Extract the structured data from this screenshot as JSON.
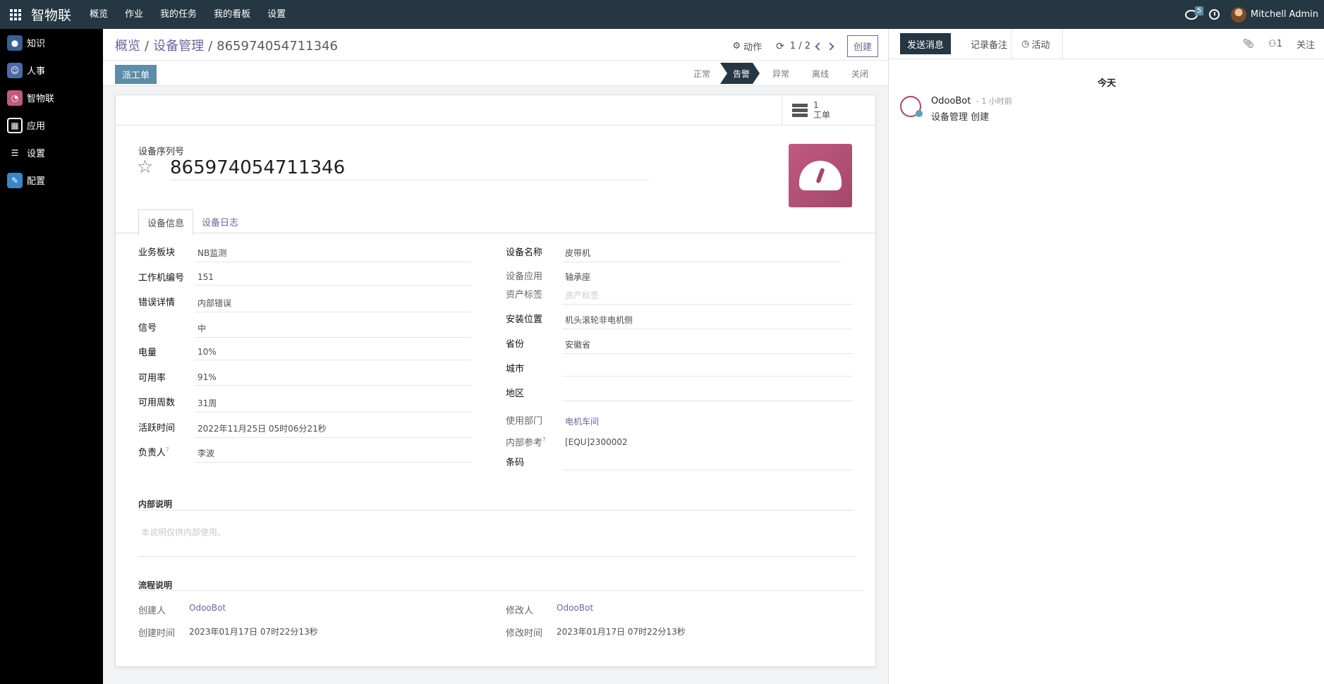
{
  "topbar": {
    "brand": "智物联",
    "menu": [
      "概览",
      "作业",
      "我的任务",
      "我的看板",
      "设置"
    ],
    "chat_count": "5",
    "user_name": "Mitchell Admin"
  },
  "sidebar": {
    "items": [
      {
        "label": "知识",
        "color": "#3a5f95"
      },
      {
        "label": "人事",
        "color": "#4c6aa6"
      },
      {
        "label": "智物联",
        "color": "#c05a80"
      },
      {
        "label": "应用",
        "color": "#000000"
      },
      {
        "label": "设置",
        "color": "#000000"
      },
      {
        "label": "配置",
        "color": "#3a86c8"
      }
    ]
  },
  "control_panel": {
    "breadcrumb": [
      "概览",
      "设备管理",
      "865974054711346"
    ],
    "action_label": "动作",
    "pager": "1 / 2",
    "create_label": "创建",
    "dispatch_label": "派工单",
    "statuses": [
      "正常",
      "告警",
      "异常",
      "离线",
      "关闭"
    ],
    "active_status": "告警"
  },
  "form": {
    "smart_button": {
      "count": "1",
      "label": "工单"
    },
    "serial_label": "设备序列号",
    "serial_value": "865974054711346",
    "tabs": [
      "设备信息",
      "设备日志"
    ],
    "left_fields": [
      {
        "label": "业务板块",
        "value": "NB监测"
      },
      {
        "label": "工作机编号",
        "value": "151"
      },
      {
        "label": "错误详情",
        "value": "内部错误"
      },
      {
        "label": "信号",
        "value": "中"
      },
      {
        "label": "电量",
        "value": "10%"
      },
      {
        "label": "可用率",
        "value": "91%"
      },
      {
        "label": "可用周数",
        "value": "31周"
      },
      {
        "label": "活跃时间",
        "value": "2022年11月25日 05时06分21秒"
      },
      {
        "label": "负责人",
        "value": "李波"
      }
    ],
    "right_fields": [
      {
        "label": "设备名称",
        "value": "皮带机"
      },
      {
        "label": "设备应用",
        "value": "轴承座"
      },
      {
        "label": "资产标签",
        "value": "",
        "placeholder": "资产标签"
      },
      {
        "label": "安装位置",
        "value": "机头滚轮非电机侧"
      },
      {
        "label": "省份",
        "value": "安徽省"
      },
      {
        "label": "城市",
        "value": ""
      },
      {
        "label": "地区",
        "value": ""
      },
      {
        "label": "使用部门",
        "value": "电机车间"
      },
      {
        "label": "内部参考",
        "value": "[EQU]2300002"
      },
      {
        "label": "条码",
        "value": ""
      }
    ],
    "internal_note_title": "内部说明",
    "internal_note_placeholder": "本说明仅供内部使用。",
    "process_title": "流程说明",
    "creator_label": "创建人",
    "creator": "OdooBot",
    "created_label": "创建时间",
    "created": "2023年01月17日 07时22分13秒",
    "modifier_label": "修改人",
    "modifier": "OdooBot",
    "modified_label": "修改时间",
    "modified": "2023年01月17日 07时22分13秒"
  },
  "chatter": {
    "send_message": "发送消息",
    "log_note": "记录备注",
    "activity": "活动",
    "followers_count": "1",
    "follow_label": "关注",
    "today_label": "今天",
    "message": {
      "author": "OdooBot",
      "time": "1 小时前",
      "body": "设备管理 创建"
    }
  }
}
